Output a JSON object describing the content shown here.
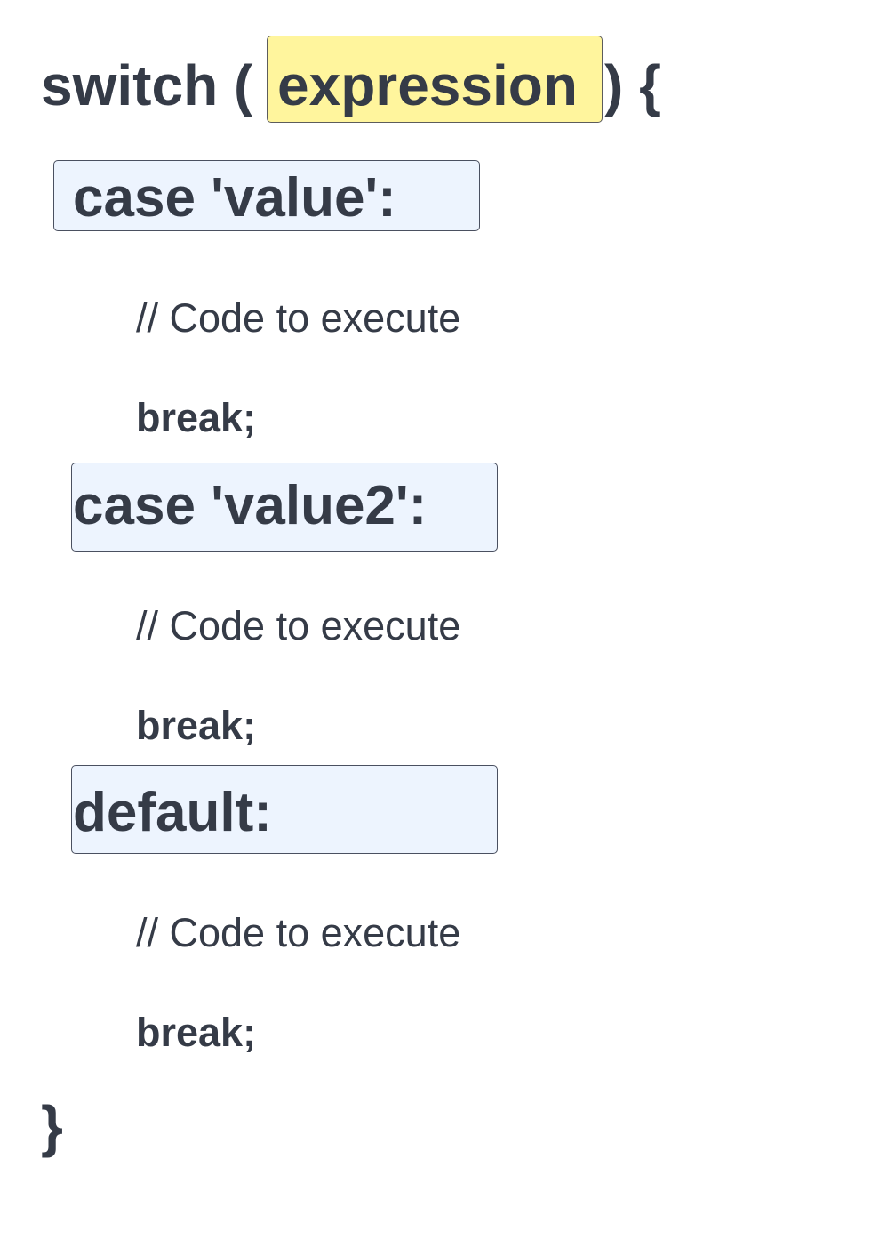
{
  "switch_header": {
    "keyword": "switch (",
    "expression": "expression",
    "closing": ") {",
    "expression_highlight": "#fff59d"
  },
  "cases": [
    {
      "label": "case 'value':",
      "comment": "// Code to execute",
      "statement": "break;"
    },
    {
      "label": "case 'value2':",
      "comment": "// Code to execute",
      "statement": "break;"
    },
    {
      "label": "default:",
      "comment": "// Code to execute",
      "statement": "break;"
    }
  ],
  "closing_brace": "}",
  "colors": {
    "text": "#353b47",
    "case_box_fill": "#edf4fe"
  }
}
